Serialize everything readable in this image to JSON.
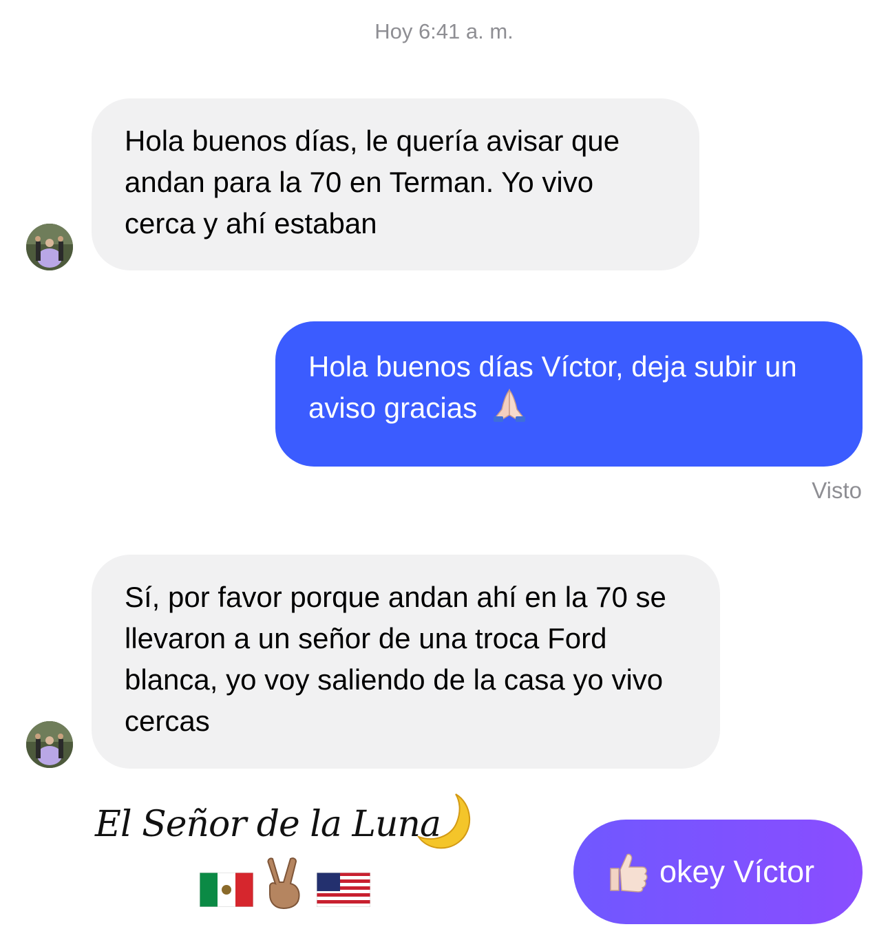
{
  "header": {
    "timestamp": "Hoy 6:41 a. m."
  },
  "messages": [
    {
      "direction": "incoming",
      "text": "Hola buenos días, le quería avisar que andan para la 70 en Terman. Yo vivo cerca y ahí estaban"
    },
    {
      "direction": "outgoing",
      "text": "Hola buenos días Víctor, deja subir un aviso gracias",
      "emoji_icon": "folded-hands-icon",
      "status": "Visto"
    },
    {
      "direction": "incoming",
      "text": "Sí, por favor porque andan ahí en la 70 se llevaron a un señor de una troca Ford blanca, yo voy saliendo de la casa yo vivo cercas"
    }
  ],
  "signature": {
    "text": "El Señor de la Luna",
    "icons": [
      "crescent-moon-icon",
      "mexico-flag-icon",
      "victory-hand-icon",
      "usa-flag-icon"
    ]
  },
  "quick_reply": {
    "icon": "thumbs-up-icon",
    "text": "okey Víctor"
  },
  "colors": {
    "incoming_bubble": "#f1f1f2",
    "outgoing_bubble": "#3b5cff",
    "reply_gradient_start": "#7058ff",
    "reply_gradient_end": "#8a4dff",
    "meta_text": "#8e8e93"
  }
}
